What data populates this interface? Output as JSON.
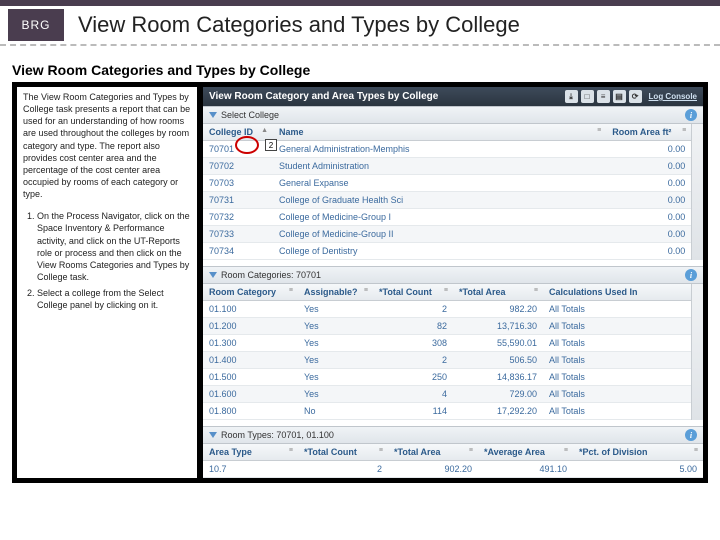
{
  "header": {
    "logo": "BRG",
    "title": "View Room Categories and Types by College"
  },
  "panel": {
    "subtitle": "View Room Categories and Types by College",
    "description": "The View Room Categories and Types by College task presents a report that can be used for an understanding of how rooms are used throughout the colleges by room category and type. The report also provides cost center area and the percentage of the cost center area occupied by rooms of each category or type.",
    "steps": [
      "On the Process Navigator, click on the Space Inventory & Performance activity, and click on the UT-Reports role or process and then click on the View Rooms Categories and Types by College task.",
      "Select a college from the Select College panel by clicking on it."
    ]
  },
  "app": {
    "title": "View Room Category and Area Types by College",
    "action_link": "Log Console",
    "select_panel": "Select College",
    "room_cat_panel": "Room Categories: 70701",
    "room_type_panel": "Room Types: 70701, 01.100",
    "cols_college": {
      "id": "College ID",
      "name": "Name",
      "area": "Room Area ft²"
    },
    "cols_cat": {
      "cat": "Room Category",
      "assign": "Assignable?",
      "count": "*Total Count",
      "area": "*Total Area",
      "calc": "Calculations Used In"
    },
    "cols_type": {
      "type": "Area Type",
      "count": "*Total Count",
      "area": "*Total Area",
      "avg": "*Average Area",
      "pct": "*Pct. of Division"
    },
    "colleges": [
      {
        "id": "70701",
        "name": "General Administration-Memphis",
        "area": "0.00"
      },
      {
        "id": "70702",
        "name": "Student Administration",
        "area": "0.00"
      },
      {
        "id": "70703",
        "name": "General Expanse",
        "area": "0.00"
      },
      {
        "id": "70731",
        "name": "College of Graduate Health Sci",
        "area": "0.00"
      },
      {
        "id": "70732",
        "name": "College of Medicine-Group I",
        "area": "0.00"
      },
      {
        "id": "70733",
        "name": "College of Medicine-Group II",
        "area": "0.00"
      },
      {
        "id": "70734",
        "name": "College of Dentistry",
        "area": "0.00"
      }
    ],
    "categories": [
      {
        "cat": "01.100",
        "assign": "Yes",
        "count": "2",
        "area": "982.20",
        "calc": "All Totals"
      },
      {
        "cat": "01.200",
        "assign": "Yes",
        "count": "82",
        "area": "13,716.30",
        "calc": "All Totals"
      },
      {
        "cat": "01.300",
        "assign": "Yes",
        "count": "308",
        "area": "55,590.01",
        "calc": "All Totals"
      },
      {
        "cat": "01.400",
        "assign": "Yes",
        "count": "2",
        "area": "506.50",
        "calc": "All Totals"
      },
      {
        "cat": "01.500",
        "assign": "Yes",
        "count": "250",
        "area": "14,836.17",
        "calc": "All Totals"
      },
      {
        "cat": "01.600",
        "assign": "Yes",
        "count": "4",
        "area": "729.00",
        "calc": "All Totals"
      },
      {
        "cat": "01.800",
        "assign": "No",
        "count": "114",
        "area": "17,292.20",
        "calc": "All Totals"
      }
    ],
    "types": [
      {
        "type": "10.7",
        "count": "2",
        "area": "902.20",
        "avg": "491.10",
        "pct": "5.00"
      }
    ]
  }
}
